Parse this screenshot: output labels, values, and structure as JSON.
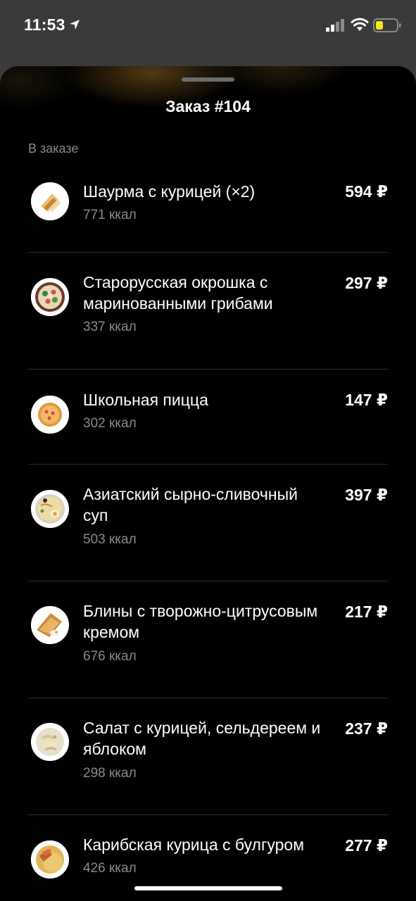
{
  "status_bar": {
    "time": "11:53",
    "icons": [
      "location-arrow-icon",
      "signal-icon",
      "wifi-icon",
      "battery-icon"
    ],
    "battery_color": "#f5e61a"
  },
  "sheet": {
    "title": "Заказ #104",
    "section_label": "В заказе"
  },
  "items": [
    {
      "name": "Шаурма с курицей (×2)",
      "kcal": "771 ккал",
      "price": "594 ₽",
      "icon": "shawarma-icon"
    },
    {
      "name": "Старорусская окрошка с маринованными грибами",
      "kcal": "337 ккал",
      "price": "297 ₽",
      "icon": "okroshka-icon"
    },
    {
      "name": "Школьная пицца",
      "kcal": "302 ккал",
      "price": "147 ₽",
      "icon": "pizza-icon"
    },
    {
      "name": "Азиатский сырно-сливочный суп",
      "kcal": "503 ккал",
      "price": "397 ₽",
      "icon": "soup-icon"
    },
    {
      "name": "Блины с творожно-цитрусовым кремом",
      "kcal": "676 ккал",
      "price": "217 ₽",
      "icon": "pancakes-icon"
    },
    {
      "name": "Салат с курицей, сельдереем и яблоком",
      "kcal": "298 ккал",
      "price": "237 ₽",
      "icon": "salad-icon"
    },
    {
      "name": "Карибская курица с булгуром",
      "kcal": "426 ккал",
      "price": "277 ₽",
      "icon": "chicken-bulgur-icon"
    }
  ]
}
